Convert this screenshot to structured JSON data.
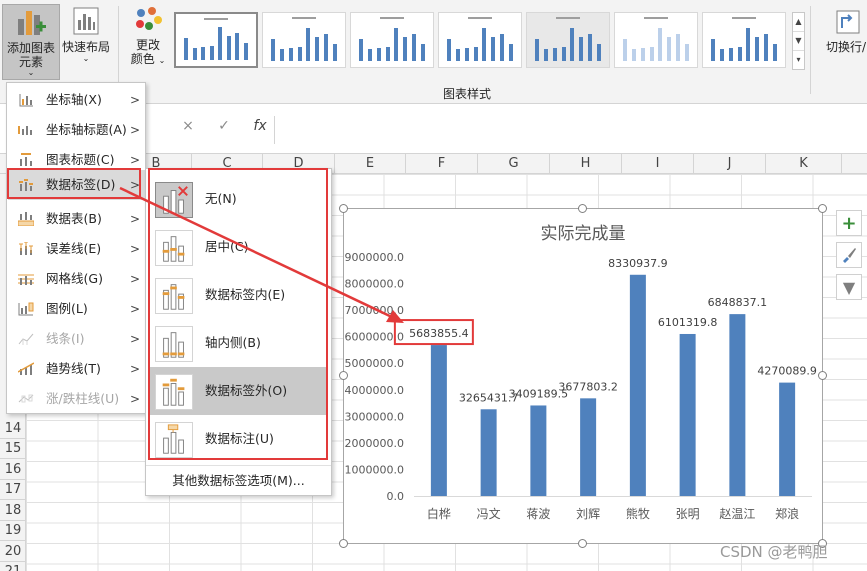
{
  "ribbon": {
    "add_element_line1": "添加图表",
    "add_element_line2": "元素",
    "quick_layout": "快速布局",
    "change_colors_line1": "更改",
    "change_colors_line2": "颜色",
    "group_label": "图表样式",
    "switch_row_col": "切换行/",
    "style_thumb_title": "实际完成量"
  },
  "formula_bar": {
    "cancel_icon": "×",
    "enter_icon": "✓",
    "fx_icon": "fx"
  },
  "columns": [
    "B",
    "C",
    "D",
    "E",
    "F",
    "G",
    "H",
    "I",
    "J",
    "K"
  ],
  "rows": [
    "14",
    "15",
    "16",
    "17",
    "18",
    "19",
    "20",
    "21"
  ],
  "menu": {
    "items": [
      {
        "label": "坐标轴(X)",
        "icon": "axis-icon",
        "arrow": ">",
        "disabled": false
      },
      {
        "label": "坐标轴标题(A)",
        "icon": "axis-title-icon",
        "arrow": ">",
        "disabled": false
      },
      {
        "label": "图表标题(C)",
        "icon": "chart-title-icon",
        "arrow": ">",
        "disabled": false
      },
      {
        "label": "数据标签(D)",
        "icon": "data-label-icon",
        "arrow": ">",
        "disabled": false,
        "active": true
      },
      {
        "label": "数据表(B)",
        "icon": "data-table-icon",
        "arrow": ">",
        "disabled": false
      },
      {
        "label": "误差线(E)",
        "icon": "error-bar-icon",
        "arrow": ">",
        "disabled": false
      },
      {
        "label": "网格线(G)",
        "icon": "gridline-icon",
        "arrow": ">",
        "disabled": false
      },
      {
        "label": "图例(L)",
        "icon": "legend-icon",
        "arrow": ">",
        "disabled": false
      },
      {
        "label": "线条(I)",
        "icon": "lines-icon",
        "arrow": ">",
        "disabled": true
      },
      {
        "label": "趋势线(T)",
        "icon": "trendline-icon",
        "arrow": ">",
        "disabled": false
      },
      {
        "label": "涨/跌柱线(U)",
        "icon": "up-down-bar-icon",
        "arrow": ">",
        "disabled": true
      }
    ]
  },
  "submenu": {
    "items": [
      {
        "label": "无(N)",
        "icon": "none-label-icon"
      },
      {
        "label": "居中(C)",
        "icon": "center-label-icon"
      },
      {
        "label": "数据标签内(E)",
        "icon": "inside-end-label-icon"
      },
      {
        "label": "轴内侧(B)",
        "icon": "inside-base-label-icon"
      },
      {
        "label": "数据标签外(O)",
        "icon": "outside-end-label-icon",
        "selected": true
      },
      {
        "label": "数据标注(U)",
        "icon": "data-callout-icon"
      }
    ],
    "more": "其他数据标签选项(M)..."
  },
  "side_tools": {
    "plus": "+",
    "filter": "▼"
  },
  "chart_data": {
    "type": "bar",
    "title": "实际完成量",
    "categories": [
      "白桦",
      "冯文",
      "蒋波",
      "刘辉",
      "熊牧",
      "张明",
      "赵温江",
      "郑浪"
    ],
    "values": [
      5683855.4,
      3265431.7,
      3409189.5,
      3677803.2,
      8330937.9,
      6101319.8,
      6848837.1,
      4270089.9
    ],
    "value_labels": [
      "5683855.4",
      "3265431.7",
      "3409189.5",
      "3677803.2",
      "8330937.9",
      "6101319.8",
      "6848837.1",
      "4270089.9"
    ],
    "y_ticks": [
      "0.0",
      "1000000.0",
      "2000000.0",
      "3000000.0",
      "4000000.0",
      "5000000.0",
      "6000000.0",
      "7000000.0",
      "8000000.0",
      "9000000.0"
    ],
    "ylim": [
      0,
      9000000
    ],
    "bar_color": "#4f81bd",
    "grid": false,
    "legend": "none",
    "highlighted_label_index": 0
  },
  "colors": {
    "highlight": "#e23a3a",
    "bar": "#4f81bd"
  },
  "watermark": "CSDN @老鸭胆"
}
